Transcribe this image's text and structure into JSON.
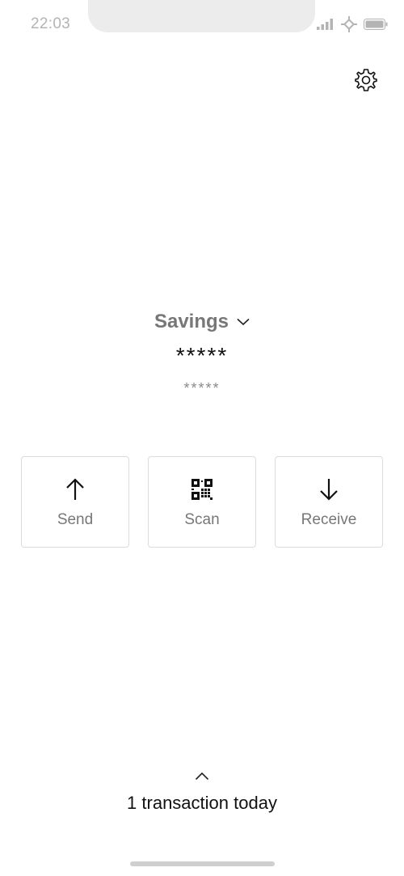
{
  "status_bar": {
    "time": "22:03",
    "icons": [
      "signal-icon",
      "wifi-icon",
      "battery-icon"
    ]
  },
  "header": {
    "settings_icon": "gear-icon"
  },
  "account": {
    "name": "Savings",
    "selector_icon": "chevron-down-icon",
    "balance_primary": "*****",
    "balance_secondary": "*****"
  },
  "actions": [
    {
      "label": "Send",
      "icon": "arrow-up-icon"
    },
    {
      "label": "Scan",
      "icon": "qr-code-icon"
    },
    {
      "label": "Receive",
      "icon": "arrow-down-icon"
    }
  ],
  "transactions": {
    "expand_icon": "chevron-up-icon",
    "summary": "1 transaction today"
  },
  "colors": {
    "primary_text": "#111111",
    "secondary_text": "#777777",
    "muted_text": "#b4b4b4",
    "card_border": "#dcdcdc"
  }
}
